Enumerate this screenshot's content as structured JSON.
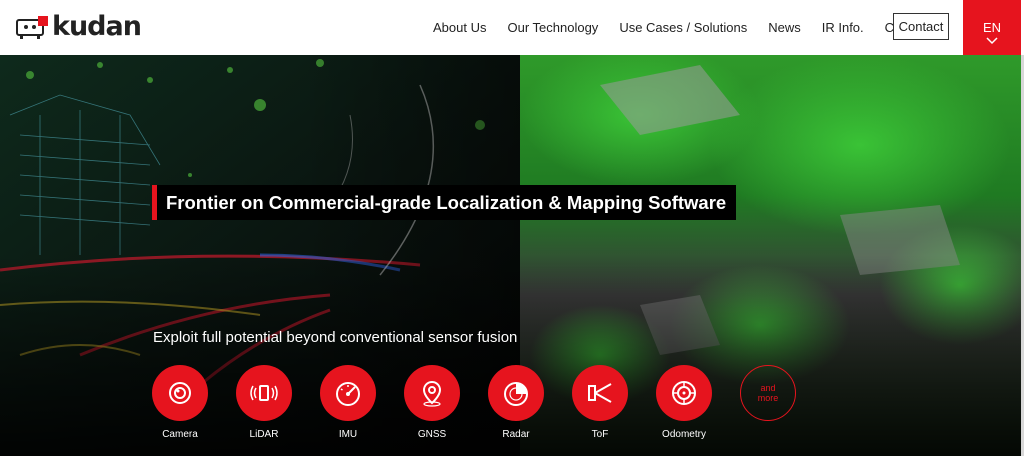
{
  "brand": {
    "name": "kudan",
    "accent": "#e6141e"
  },
  "nav": {
    "items": [
      "About Us",
      "Our Technology",
      "Use Cases / Solutions",
      "News",
      "IR Info.",
      "Careers"
    ],
    "contact_label": "Contact",
    "language_label": "EN"
  },
  "hero": {
    "headline": "Frontier on Commercial-grade Localization & Mapping Software",
    "subline": "Exploit full potential beyond conventional sensor fusion",
    "sensors": [
      {
        "label": "Camera",
        "icon": "camera-icon"
      },
      {
        "label": "LiDAR",
        "icon": "lidar-icon"
      },
      {
        "label": "IMU",
        "icon": "imu-icon"
      },
      {
        "label": "GNSS",
        "icon": "gnss-icon"
      },
      {
        "label": "Radar",
        "icon": "radar-icon"
      },
      {
        "label": "ToF",
        "icon": "tof-icon"
      },
      {
        "label": "Odometry",
        "icon": "odometry-icon"
      }
    ],
    "more_line1": "and",
    "more_line2": "more"
  }
}
